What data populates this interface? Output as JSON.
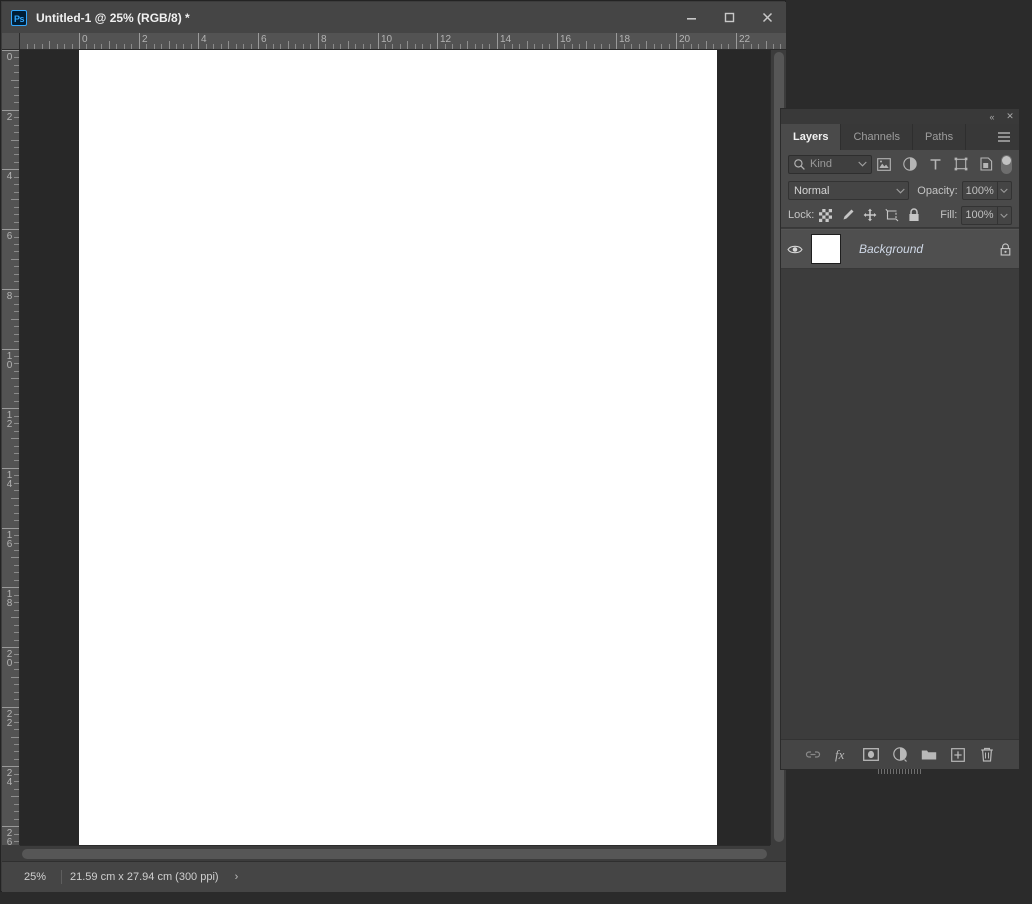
{
  "window": {
    "app_icon": "Ps",
    "title": "Untitled-1 @ 25% (RGB/8) *",
    "minimize_label": "minimize-icon",
    "maximize_label": "maximize-icon",
    "close_label": "close-icon"
  },
  "rulers": {
    "unit": "cm",
    "horizontal_labels": [
      "0",
      "2",
      "4",
      "6",
      "8",
      "10",
      "12",
      "14",
      "16",
      "18",
      "20",
      "22"
    ],
    "vertical_labels": [
      "0",
      "2",
      "4",
      "6",
      "8",
      "10",
      "12",
      "14",
      "16",
      "18",
      "20",
      "22",
      "24",
      "26"
    ]
  },
  "status": {
    "zoom": "25%",
    "doc_info": "21.59 cm x 27.94 cm (300 ppi)",
    "expand_arrow": "›"
  },
  "panel": {
    "collapse_icon": "«",
    "close_icon": "✕",
    "menu_icon": "panel-menu-icon",
    "tabs": [
      {
        "label": "Layers",
        "active": true
      },
      {
        "label": "Channels",
        "active": false
      },
      {
        "label": "Paths",
        "active": false
      }
    ],
    "filter": {
      "kind_label": "Kind",
      "search_icon": "search-icon",
      "icons": [
        "pixel-layer-filter-icon",
        "adjustment-layer-filter-icon",
        "type-layer-filter-icon",
        "shape-layer-filter-icon",
        "smart-object-filter-icon"
      ],
      "toggle_state": "on"
    },
    "blend": {
      "mode": "Normal",
      "opacity_label": "Opacity:",
      "opacity_value": "100%"
    },
    "lock": {
      "label": "Lock:",
      "icons": [
        "lock-transparent-pixels-icon",
        "lock-image-pixels-icon",
        "lock-position-icon",
        "lock-artboard-nesting-icon",
        "lock-all-icon"
      ],
      "fill_label": "Fill:",
      "fill_value": "100%"
    },
    "layers": [
      {
        "name": "Background",
        "visible": true,
        "locked": true,
        "thumbnail_color": "#ffffff"
      }
    ],
    "footer_buttons": [
      {
        "name": "link-layers-button",
        "icon": "link-icon"
      },
      {
        "name": "layer-style-button",
        "icon": "fx-icon"
      },
      {
        "name": "add-layer-mask-button",
        "icon": "mask-icon"
      },
      {
        "name": "new-adjustment-layer-button",
        "icon": "adjustment-icon"
      },
      {
        "name": "new-group-button",
        "icon": "folder-icon"
      },
      {
        "name": "new-layer-button",
        "icon": "plus-square-icon"
      },
      {
        "name": "delete-layer-button",
        "icon": "trash-icon"
      }
    ]
  },
  "colors": {
    "panel_bg": "#3c3c3c",
    "panel_row_bg": "#4a4a4a",
    "active_tab_bg": "#4a4a4a",
    "canvas_bg": "#282828",
    "sheet": "#ffffff",
    "accent_blue": "#31a8ff",
    "layer_selected": "#4f4f4f"
  }
}
